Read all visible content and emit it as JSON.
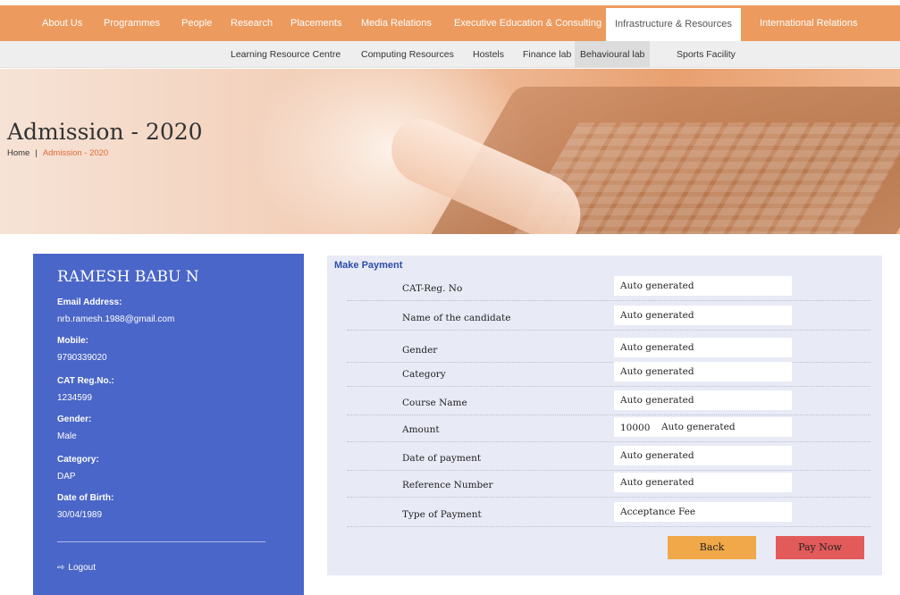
{
  "topnav": {
    "items": [
      "About Us",
      "Programmes",
      "People",
      "Research",
      "Placements",
      "Media Relations",
      "Executive Education & Consulting",
      "Infrastructure & Resources",
      "International Relations"
    ]
  },
  "subnav": {
    "items": [
      "Learning Resource Centre",
      "Computing Resources",
      "Hostels",
      "Finance lab",
      "Behavioural lab",
      "Sports Facility"
    ]
  },
  "banner": {
    "title": "Admission - 2020",
    "breadcrumb": {
      "home": "Home",
      "separator": "|",
      "current": "Admission - 2020"
    }
  },
  "profile": {
    "name": "RAMESH BABU N",
    "fields": [
      {
        "label": "Email Address:",
        "value": "nrb.ramesh.1988@gmail.com"
      },
      {
        "label": "Mobile:",
        "value": "9790339020"
      },
      {
        "label": "CAT Reg.No.:",
        "value": "1234599"
      },
      {
        "label": "Gender:",
        "value": "Male"
      },
      {
        "label": "Category:",
        "value": "DAP"
      },
      {
        "label": "Date of Birth:",
        "value": "30/04/1989"
      }
    ],
    "logout": "Logout"
  },
  "payment": {
    "heading": "Make Payment",
    "rows": [
      {
        "label": "CAT-Reg. No",
        "value": "Auto generated"
      },
      {
        "label": "Name of the candidate",
        "value": "Auto generated"
      },
      {
        "label": "Gender",
        "value": "Auto generated"
      },
      {
        "label": "Category",
        "value": "Auto generated"
      },
      {
        "label": "Course Name",
        "value": "Auto generated"
      },
      {
        "label": "Amount",
        "prefix": "10000",
        "value": "Auto generated"
      },
      {
        "label": "Date of payment",
        "value": "Auto generated"
      },
      {
        "label": "Reference Number",
        "value": "Auto generated"
      },
      {
        "label": "Type of Payment",
        "value": "Acceptance Fee"
      }
    ],
    "back_label": "Back",
    "pay_label": "Pay Now"
  },
  "colors": {
    "nav_orange": "#ec9a5e",
    "profile_blue": "#4a66c8",
    "panel_bg": "#e8eaf6",
    "back_button": "#f0a848",
    "pay_button": "#e25a5a",
    "breadcrumb_current": "#e06a3a"
  }
}
